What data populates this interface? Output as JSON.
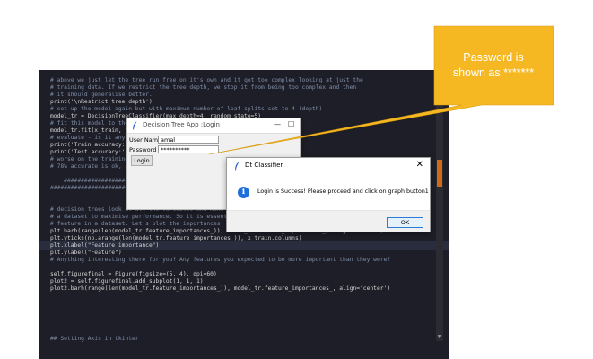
{
  "editor": {
    "lines": [
      {
        "html_class": "cmt",
        "text": "# above we just let the tree run free on it's own and it got too complex looking at just the"
      },
      {
        "html_class": "cmt",
        "text": "# training data. If we restrict the tree depth, we stop it from being too complex and then"
      },
      {
        "html_class": "cmt",
        "text": "# it should generalise better."
      },
      {
        "html_class": "",
        "text": "print('\\nRestrict tree depth')"
      },
      {
        "html_class": "cmt",
        "text": "# set up the model again but with maximum number of leaf splits set to 4 (depth)"
      },
      {
        "html_class": "",
        "text": "model_tr = DecisionTreeClassifier(max_depth=4, random_state=5)"
      },
      {
        "html_class": "cmt",
        "text": "# fit this model to the training data"
      },
      {
        "html_class": "",
        "text": "model_tr.fit(x_train, y_train)"
      },
      {
        "html_class": "cmt",
        "text": "# evaluate - is it any better?"
      },
      {
        "html_class": "",
        "text": "print('Train accuracy:', model_tr.score(x_train, y_train))"
      },
      {
        "html_class": "",
        "text": "print('Test accuracy:', model_tr.score(x_test, y_test))"
      },
      {
        "html_class": "cmt",
        "text": "# worse on the training data but better on the test data"
      },
      {
        "html_class": "cmt",
        "text": "# 78% accurate is ok, and it generalises better"
      },
      {
        "html_class": "",
        "text": ""
      },
      {
        "html_class": "cmt",
        "text": "    ###############################################"
      },
      {
        "html_class": "cmt",
        "text": "#####################################################"
      },
      {
        "html_class": "",
        "text": ""
      },
      {
        "html_class": "",
        "text": ""
      },
      {
        "html_class": "cmt",
        "text": "# decision trees look at all the variables and make decisions"
      },
      {
        "html_class": "cmt",
        "text": "# a dataset to maximise performance. So it is essential to understand"
      },
      {
        "html_class": "cmt",
        "text": "# feature in a dataset. Let's plot the importances"
      },
      {
        "html_class": "",
        "text": "plt.barh(range(len(model_tr.feature_importances_)), model_tr.feature_importances_, align='center')"
      },
      {
        "html_class": "",
        "text": "plt.yticks(np.arange(len(model_tr.feature_importances_)), x_train.columns)"
      },
      {
        "html_class": "",
        "text": "plt.xlabel(\"Feature importance\")"
      },
      {
        "html_class": "",
        "text": "plt.ylabel(\"Feature\")"
      },
      {
        "html_class": "cmt",
        "text": "# Anything interesting there for you? Any features you expected to be more important than they were?"
      },
      {
        "html_class": "",
        "text": ""
      },
      {
        "html_class": "",
        "text": "self.figurefinal = Figure(figsize=(5, 4), dpi=60)"
      },
      {
        "html_class": "",
        "text": "plot2 = self.figurefinal.add_subplot(1, 1, 1)"
      },
      {
        "html_class": "",
        "text": "plot2.barh(range(len(model_tr.feature_importances_)), model_tr.feature_importances_, align='center')"
      },
      {
        "html_class": "",
        "text": ""
      },
      {
        "html_class": "",
        "text": ""
      },
      {
        "html_class": "",
        "text": ""
      },
      {
        "html_class": "",
        "text": ""
      },
      {
        "html_class": "",
        "text": ""
      },
      {
        "html_class": "",
        "text": ""
      },
      {
        "html_class": "cmt",
        "text": "## Setting Axis in tkinter"
      }
    ]
  },
  "login_window": {
    "title": "Decision Tree App :Login",
    "username_label": "User Name",
    "username_value": "amal",
    "password_label": "Password",
    "password_value": "**********",
    "login_button": "Login",
    "minimize": "—",
    "maximize": "☐"
  },
  "message_dialog": {
    "title": "Dt Classifier",
    "close": "✕",
    "icon": "i",
    "message": "Login is Success! Please proceed and click on graph button1",
    "ok_button": "OK"
  },
  "callout": {
    "text_line1": "Password is",
    "text_line2": "shown as *******",
    "color": "#f5b823"
  },
  "scrollbar": {
    "thumb_color": "#cc6a1a"
  }
}
